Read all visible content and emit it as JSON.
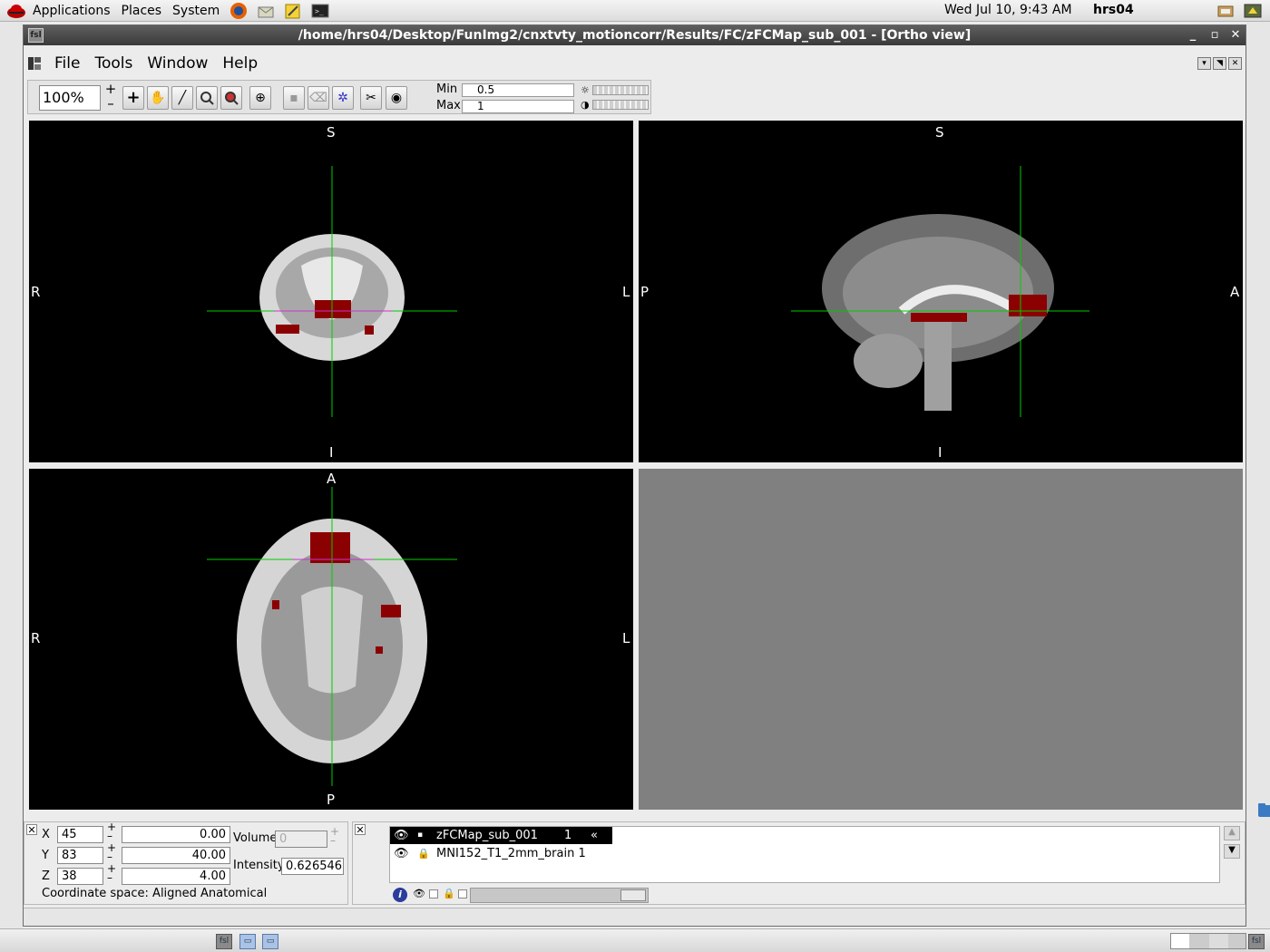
{
  "top_panel": {
    "menus": [
      "Applications",
      "Places",
      "System"
    ],
    "clock": "Wed Jul 10,  9:43 AM",
    "user": "hrs04"
  },
  "window": {
    "title": "/home/hrs04/Desktop/FunImg2/cnxtvty_motioncorr/Results/FC/zFCMap_sub_001 - [Ortho view]",
    "app_icon": "fsl",
    "controls": [
      "_",
      "▫",
      "✕"
    ]
  },
  "menubar": {
    "file": "File",
    "tools": "Tools",
    "window": "Window",
    "help": "Help"
  },
  "toolbar": {
    "zoom": "100%",
    "plus": "+",
    "minus": "–",
    "min_label": "Min",
    "min_value": "0.5",
    "max_label": "Max",
    "max_value": "1"
  },
  "views": {
    "coronal": {
      "top": "S",
      "bottom": "I",
      "left": "R",
      "right": "L"
    },
    "sagittal": {
      "top": "S",
      "bottom": "I",
      "left": "P",
      "right": "A"
    },
    "axial": {
      "top": "A",
      "bottom": "P",
      "left": "R",
      "right": "L"
    }
  },
  "coords": {
    "x_label": "X",
    "x_vox": "45",
    "x_mm": "0.00",
    "y_label": "Y",
    "y_vox": "83",
    "y_mm": "40.00",
    "z_label": "Z",
    "z_vox": "38",
    "z_mm": "4.00",
    "volume_label": "Volume",
    "volume_value": "0",
    "intensity_label": "Intensity",
    "intensity_value": "0.626546",
    "coordinate_space": "Coordinate space: Aligned Anatomical"
  },
  "layers": [
    {
      "name": "zFCMap_sub_001",
      "num": "1",
      "selected": true
    },
    {
      "name": "MNI152_T1_2mm_brain 1",
      "num": "",
      "selected": false
    }
  ],
  "colors": {
    "crosshair": "#00cc00",
    "overlay": "#8b0000",
    "titlebar": "#4a4a4a"
  }
}
